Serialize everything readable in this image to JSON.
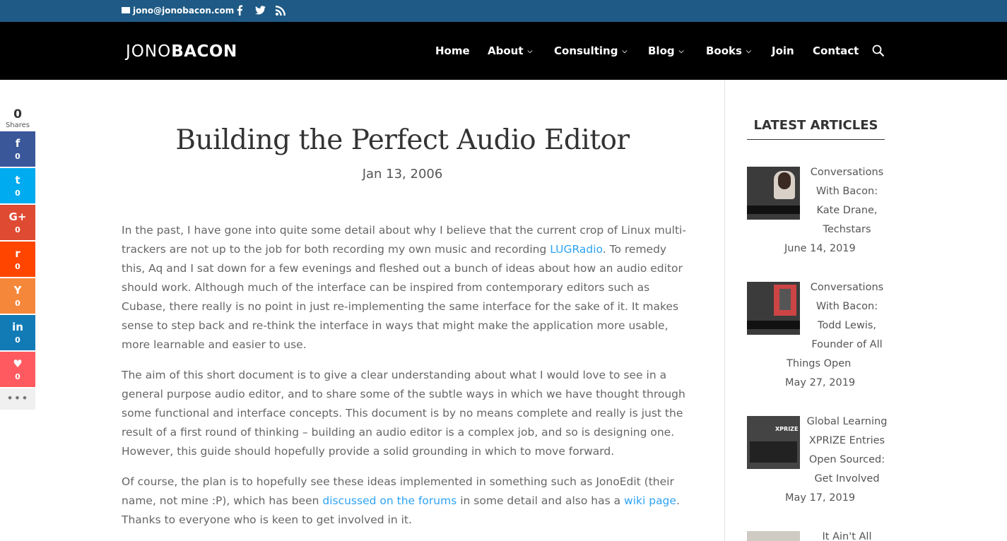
{
  "topbar": {
    "email": "jono@jonobacon.com",
    "social": [
      "facebook-icon",
      "twitter-icon",
      "rss-icon"
    ]
  },
  "header": {
    "logo_part1": "JONO",
    "logo_part2": "BACON",
    "nav": [
      {
        "label": "Home",
        "has_dropdown": false
      },
      {
        "label": "About",
        "has_dropdown": true
      },
      {
        "label": "Consulting",
        "has_dropdown": true
      },
      {
        "label": "Blog",
        "has_dropdown": true
      },
      {
        "label": "Books",
        "has_dropdown": true
      },
      {
        "label": "Join",
        "has_dropdown": false
      },
      {
        "label": "Contact",
        "has_dropdown": false
      }
    ],
    "chevron": "⌄"
  },
  "share": {
    "total": "0",
    "total_label": "Shares",
    "buttons": [
      {
        "network": "facebook",
        "icon": "f",
        "count": "0",
        "color": "#3a579a"
      },
      {
        "network": "twitter",
        "icon": "t",
        "count": "0",
        "color": "#00abf0"
      },
      {
        "network": "google-plus",
        "icon": "G+",
        "count": "0",
        "color": "#df4a32"
      },
      {
        "network": "reddit",
        "icon": "r",
        "count": "0",
        "color": "#ff4500"
      },
      {
        "network": "hacker-news",
        "icon": "Y",
        "count": "0",
        "color": "#f5873b"
      },
      {
        "network": "linkedin",
        "icon": "in",
        "count": "0",
        "color": "#127bb6"
      },
      {
        "network": "love",
        "icon": "♥",
        "count": "0",
        "color": "#ff5a5f"
      }
    ],
    "more": "•••"
  },
  "article": {
    "title": "Building the Perfect Audio Editor",
    "date": "Jan 13, 2006",
    "p1": {
      "before_link": "In the past, I have gone into quite some detail about why I believe that the current crop of Linux multi-trackers are not up to the job for both recording my own music and recording ",
      "link": "LUGRadio",
      "after_link": ". To remedy this, Aq and I sat down for a few evenings and fleshed out a bunch of ideas about how an audio editor should work. Although much of the interface can be inspired from contemporary editors such as Cubase, there really is no point in just re-implementing the same interface for the sake of it. It makes sense to step back and re-think the interface in ways that might make the application more usable, more learnable and easier to use."
    },
    "p2": "The aim of this short document is to give a clear understanding about what I would love to see in a general purpose audio editor, and to share some of the subtle ways in which we have thought through some functional and interface concepts. This document is by no means complete and really is just the result of a first round of thinking – building an audio editor is a complex job, and so is designing one. However, this guide should hopefully provide a solid grounding in which to move forward.",
    "p3": {
      "part1": "Of course, the plan is to hopefully see these ideas implemented in something such as JonoEdit (their name, not mine :P), which has been ",
      "link1": "discussed on the forums",
      "part2": " in some detail and also has a ",
      "link2": "wiki page",
      "part3": ". Thanks to everyone who is keen to get involved in it."
    }
  },
  "sidebar": {
    "title": "LATEST ARTICLES",
    "articles": [
      {
        "lines": [
          "Conversations",
          "With Bacon:",
          "Kate Drane,",
          "Techstars"
        ],
        "date": "June 14, 2019"
      },
      {
        "lines": [
          "Conversations",
          "With Bacon:",
          "Todd Lewis,",
          "Founder of All"
        ],
        "tail": "Things Open",
        "date": "May 27, 2019"
      },
      {
        "lines": [
          "Global Learning",
          "XPRIZE Entries",
          "Open Sourced:",
          "Get Involved"
        ],
        "date": "May 17, 2019"
      },
      {
        "lines": [
          "It Ain't All"
        ],
        "date": ""
      }
    ]
  }
}
